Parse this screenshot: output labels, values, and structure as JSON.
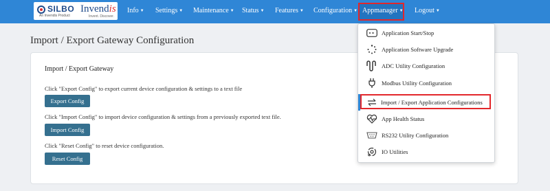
{
  "logo": {
    "brand": "SILBO",
    "sub": "An Invendis Product",
    "company_main": "Invend",
    "company_accent": "is",
    "tagline": "Invent. Discover."
  },
  "nav": {
    "items": [
      {
        "label": "Info"
      },
      {
        "label": "Settings"
      },
      {
        "label": "Maintenance"
      },
      {
        "label": "Status"
      },
      {
        "label": "Features"
      },
      {
        "label": "Configuration"
      },
      {
        "label": "Appmanager"
      },
      {
        "label": "Logout"
      }
    ]
  },
  "page": {
    "title": "Import / Export Gateway Configuration"
  },
  "card": {
    "title": "Import / Export Gateway",
    "export_desc": "Click \"Export Config\" to export current device configuration & settings to a text file",
    "export_button": "Export Config",
    "import_desc": "Click \"Import Config\" to import device configuration & settings from a previously exported text file.",
    "import_button": "Import Config",
    "reset_desc": "Click \"Reset Config\" to reset device configuration.",
    "reset_button": "Reset Config"
  },
  "dropdown": {
    "items": [
      {
        "label": "Application Start/Stop",
        "icon": "terminal-icon"
      },
      {
        "label": "Application Software Upgrade",
        "icon": "loading-dots-icon"
      },
      {
        "label": "ADC Utility Configuration",
        "icon": "waveform-icon"
      },
      {
        "label": "Modbus Utility Configuration",
        "icon": "plug-icon"
      },
      {
        "label": "Import / Export Application Configurations",
        "icon": "swap-arrows-icon",
        "active": true
      },
      {
        "label": "App Health Status",
        "icon": "heartbeat-icon"
      },
      {
        "label": "RS232 Utility Configuration",
        "icon": "serial-port-icon"
      },
      {
        "label": "IO Utilities",
        "icon": "gear-sync-icon"
      }
    ]
  },
  "colors": {
    "navbar": "#2f86d6",
    "button": "#35708f",
    "highlight": "#e3262a"
  }
}
